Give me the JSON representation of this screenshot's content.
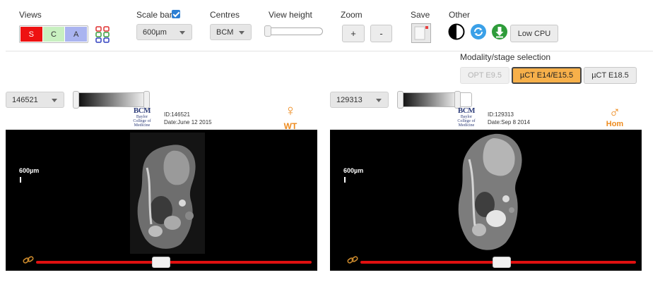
{
  "toolbar": {
    "views": {
      "label": "Views",
      "buttons": [
        "S",
        "C",
        "A"
      ]
    },
    "scale_bar": {
      "label": "Scale bar",
      "checked": true,
      "selected": "600µm"
    },
    "centres": {
      "label": "Centres",
      "selected": "BCM"
    },
    "view_height": {
      "label": "View height"
    },
    "zoom": {
      "label": "Zoom",
      "plus": "+",
      "minus": "-"
    },
    "save": {
      "label": "Save"
    },
    "other": {
      "label": "Other",
      "low_cpu": "Low CPU"
    }
  },
  "modality": {
    "label": "Modality/stage selection",
    "options": [
      "OPT E9.5",
      "µCT E14/E15.5",
      "µCT E18.5"
    ],
    "selected": "µCT E14/E15.5"
  },
  "left_panel": {
    "specimen": "146521",
    "centre_logo": {
      "main": "BCM",
      "sub1": "Baylor",
      "sub2": "College of",
      "sub3": "Medicine"
    },
    "id_text": "ID:146521",
    "date_text": "Date:June 12 2015",
    "sex_symbol": "♀",
    "genotype": "WT",
    "scale_label": "600µm",
    "slice_position": 0.45
  },
  "right_panel": {
    "specimen": "129313",
    "centre_logo": {
      "main": "BCM",
      "sub1": "Baylor",
      "sub2": "College of",
      "sub3": "Medicine"
    },
    "id_text": "ID:129313",
    "date_text": "Date:Sep 8 2014",
    "sex_symbol": "♂",
    "genotype": "Hom",
    "scale_label": "600µm",
    "slice_position": 0.5
  },
  "colors": {
    "accent": "#f7b04a",
    "slider": "#e01010",
    "checkbox": "#2d7fd3",
    "genotype": "#ee8b1e"
  }
}
